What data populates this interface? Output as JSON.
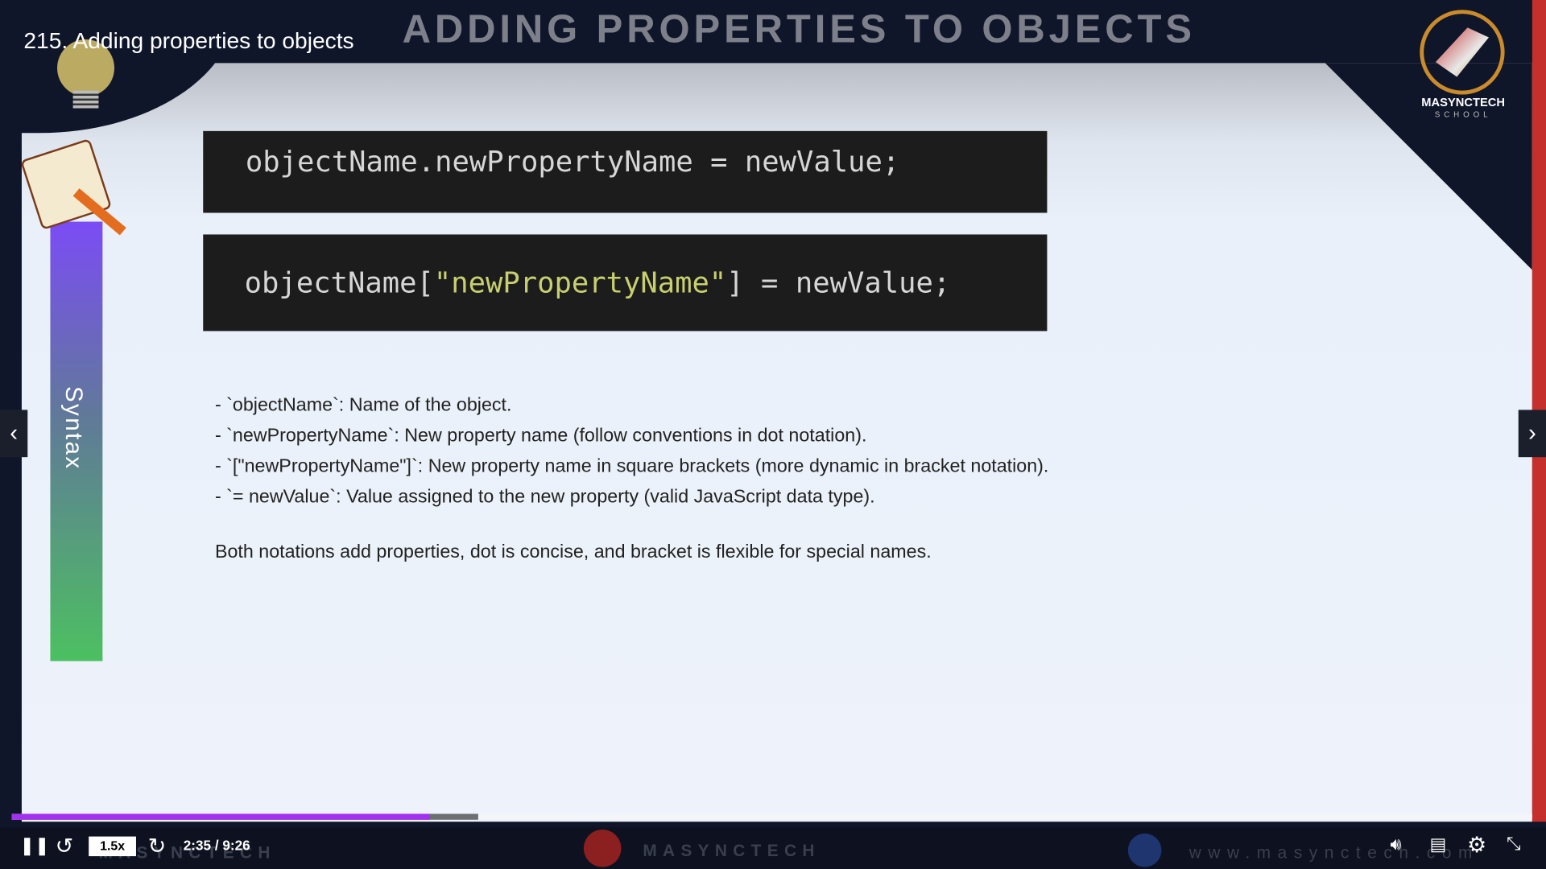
{
  "video": {
    "title": "215. Adding properties to objects"
  },
  "slide": {
    "heading": "ADDING PROPERTIES TO OBJECTS",
    "logo": {
      "name": "MASYNCTECH",
      "sub": "SCHOOL"
    },
    "side_label": "Syntax",
    "code1": "objectName.newPropertyName = newValue;",
    "code2": {
      "before": "objectName[",
      "string": "\"newPropertyName\"",
      "after": "] = newValue;"
    },
    "bullets": [
      "- `objectName`: Name of the object.",
      "- `newPropertyName`: New property name (follow conventions in dot notation).",
      "- `[\"newPropertyName\"]`: New property name in square brackets (more dynamic in bracket notation).",
      "- `= newValue`: Value assigned to the new property (valid JavaScript data type)."
    ],
    "summary": "Both notations add properties, dot is concise, and bracket is flexible for special names."
  },
  "player": {
    "progress_played_percent": 27.5,
    "progress_buffered_percent": 30.7,
    "speed": "1.5x",
    "time": "2:35 / 9:26",
    "watermark_left": "MASYNCTECH",
    "watermark_center": "MASYNCTECH",
    "watermark_right": "www.masynctech.com",
    "colors": {
      "accent": "#a331f0",
      "brand_red": "#c5302c"
    }
  }
}
